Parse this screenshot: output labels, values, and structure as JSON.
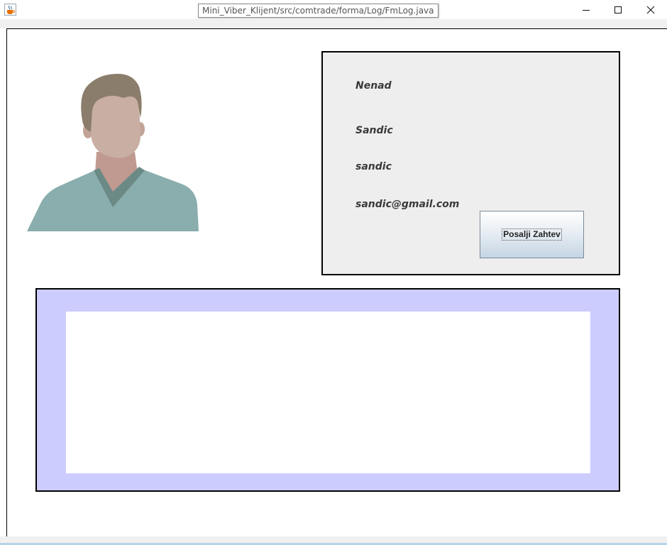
{
  "window": {
    "title_tooltip": "Mini_Viber_Klijent/src/comtrade/forma/Log/FmLog.java",
    "app_icon": "java-cup-icon",
    "controls": [
      "minimize-icon",
      "maximize-icon",
      "close-icon"
    ]
  },
  "profile": {
    "avatar_icon": "user-avatar-icon",
    "first_name": "Nenad",
    "last_name": "Sandic",
    "username": "sandic",
    "email": "sandic@gmail.com",
    "send_request_label": "Posalji Zahtev"
  },
  "messages": {
    "content": ""
  },
  "colors": {
    "info_panel_bg": "#eeeeee",
    "messages_panel_bg": "#ccccff",
    "avatar_shirt": "#8aadad",
    "avatar_skin": "#c9aea3",
    "avatar_hair": "#8b7d6b"
  }
}
